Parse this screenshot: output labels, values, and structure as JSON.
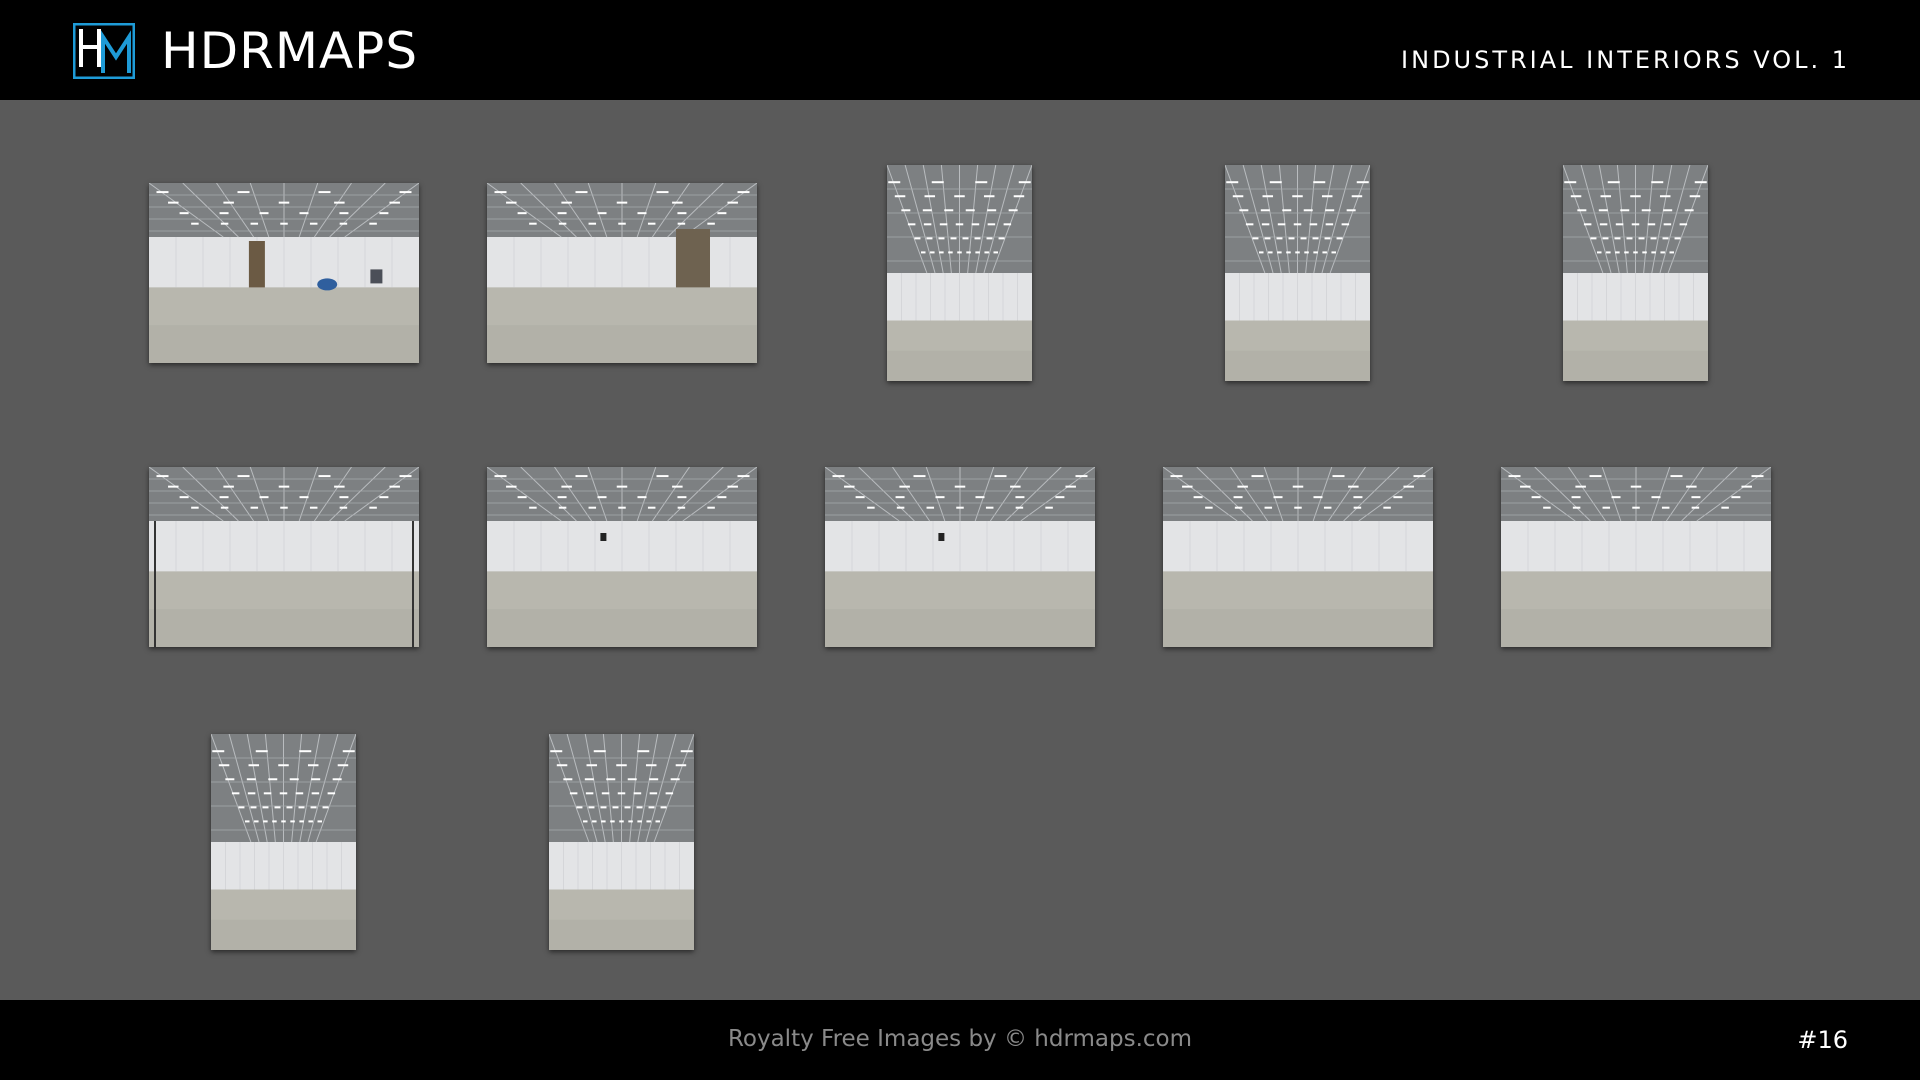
{
  "header": {
    "logo_text": "HDRMAPS",
    "collection_title": "INDUSTRIAL INTERIORS VOL. 1"
  },
  "gallery": {
    "thumbnails": [
      {
        "orientation": "landscape",
        "variant": "door-left-blue-object"
      },
      {
        "orientation": "landscape",
        "variant": "door-right"
      },
      {
        "orientation": "portrait",
        "variant": "ceiling-lights"
      },
      {
        "orientation": "portrait",
        "variant": "ceiling-lights"
      },
      {
        "orientation": "portrait",
        "variant": "ceiling-lights"
      },
      {
        "orientation": "landscape",
        "variant": "hall-center"
      },
      {
        "orientation": "landscape",
        "variant": "hall-corner"
      },
      {
        "orientation": "landscape",
        "variant": "hall-corner"
      },
      {
        "orientation": "landscape",
        "variant": "hall-wide"
      },
      {
        "orientation": "landscape",
        "variant": "hall-wide"
      },
      {
        "orientation": "portrait",
        "variant": "ceiling-lights"
      },
      {
        "orientation": "portrait",
        "variant": "ceiling-lights"
      }
    ]
  },
  "footer": {
    "credit": "Royalty Free Images by © hdrmaps.com",
    "page_number": "#16"
  },
  "colors": {
    "header_bg": "#000000",
    "page_bg": "#5a5a5a",
    "logo_accent": "#1e9bd7",
    "credit_text": "#8a8a8a"
  }
}
